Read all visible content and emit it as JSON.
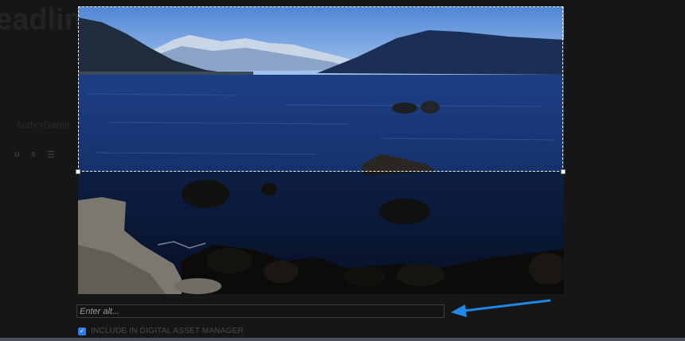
{
  "background": {
    "heading": "eadlin",
    "subtext": "AuthorName",
    "toolbar_icons": [
      "u",
      "s",
      "list"
    ]
  },
  "image_editor": {
    "image_description_icon": "landscape-photo",
    "alt_input": {
      "placeholder": "Enter alt...",
      "value": ""
    },
    "dam_checkbox": {
      "checked": true,
      "label": "INCLUDE IN DIGITAL ASSET MANAGER"
    }
  },
  "colors": {
    "accent": "#2f7cf6",
    "arrow": "#1e88e5",
    "background": "#161616"
  }
}
